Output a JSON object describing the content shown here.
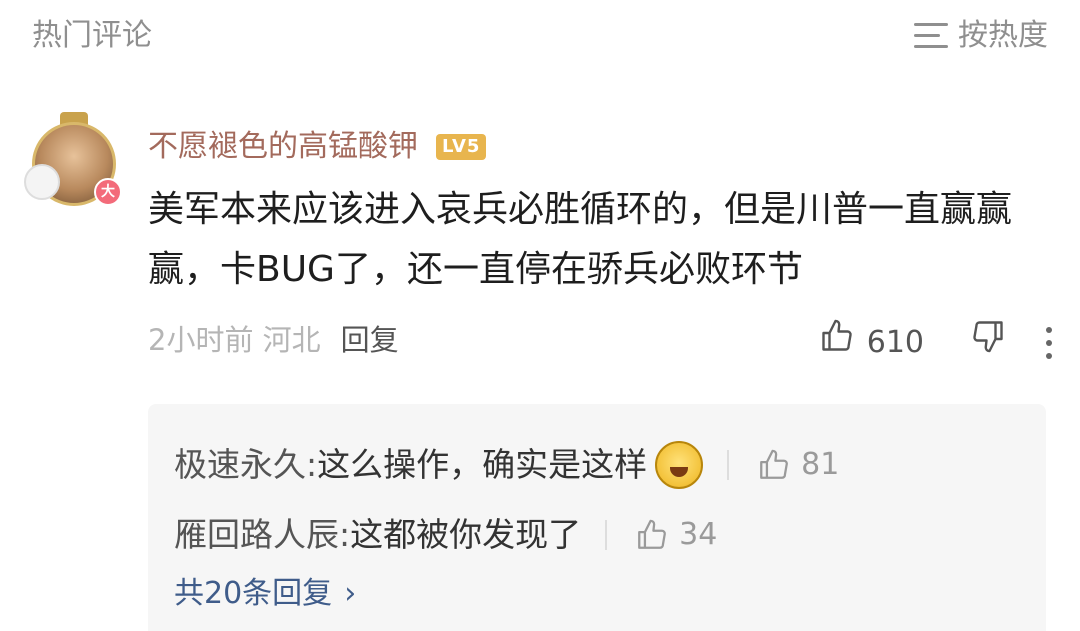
{
  "header": {
    "title": "热门评论",
    "sort_label": "按热度",
    "sort_icon": "menu-lines-icon"
  },
  "comment": {
    "username": "不愿褪色的高锰酸钾",
    "level": "LV5",
    "text": "美军本来应该进入哀兵必胜循环的，但是川普一直赢赢赢，卡BUG了，还一直停在骄兵必败环节",
    "time_location": "2小时前 河北",
    "reply_label": "回复",
    "like_count": "610",
    "like_icon": "thumbs-up-icon",
    "dislike_icon": "thumbs-down-icon",
    "more_icon": "more-vertical-icon"
  },
  "replies": [
    {
      "author": "极速永久:",
      "text": "这么操作，确实是这样",
      "emoji": "laughing-emoji",
      "likes": "81"
    },
    {
      "author": "雁回路人辰:",
      "text": "这都被你发现了",
      "likes": "34"
    }
  ],
  "more_replies_label": "共20条回复",
  "colors": {
    "username": "#a36a5c",
    "level_badge": "#e8b54e",
    "link": "#3f5c8a",
    "muted": "#8f8f8f"
  }
}
